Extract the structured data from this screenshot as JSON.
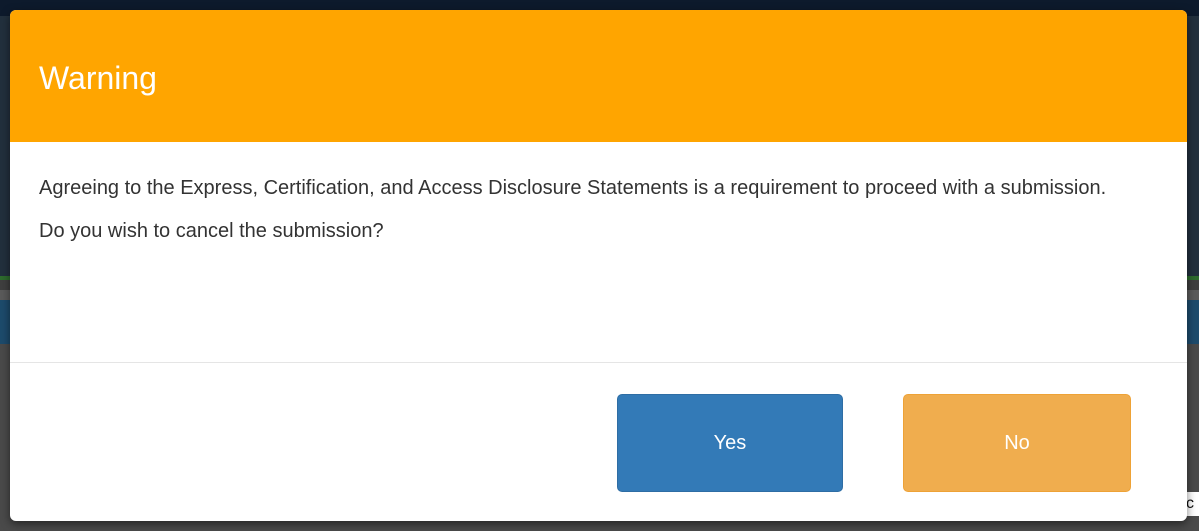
{
  "dialog": {
    "title": "Warning",
    "message": "Agreeing to the Express, Certification, and Access Disclosure Statements is a requirement to proceed with a submission.",
    "question": "Do you wish to cancel the submission?",
    "yes_label": "Yes",
    "no_label": "No"
  },
  "background": {
    "edge_glyph": "c"
  },
  "colors": {
    "header": "#ffa500",
    "yes_button": "#337ab7",
    "no_button": "#f0ad4e",
    "title_text": "#ffffff",
    "body_text": "#333333"
  }
}
